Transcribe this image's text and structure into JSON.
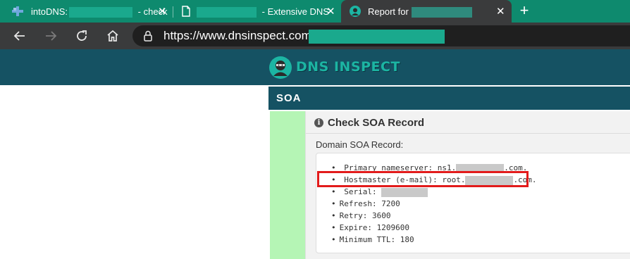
{
  "browser": {
    "tabs": [
      {
        "title": "intoDNS:",
        "suffix": "- check",
        "icon": "intodns-favicon-icon"
      },
      {
        "title": "",
        "suffix": "- Extensive DNS",
        "icon": "document-icon"
      },
      {
        "title": "Report for",
        "suffix": "",
        "icon": "dnsinspect-favicon-icon",
        "active": true
      }
    ],
    "close_glyph": "✕",
    "new_tab_glyph": "+",
    "url": "https://www.dnsinspect.com/",
    "accent": "#0e8a6e"
  },
  "site": {
    "logo_text": "DNS INSPECT",
    "header_color": "#155263"
  },
  "section": {
    "title": "SOA",
    "panel_title": "Check SOA Record",
    "domain_label": "Domain SOA Record:",
    "records": {
      "primary_ns_prefix": "Primary nameserver: ns1.",
      "primary_ns_suffix": ".com.",
      "hostmaster_prefix": "Hostmaster (e-mail): root.",
      "hostmaster_suffix": ".com.",
      "serial": "Serial:",
      "refresh": "Refresh: 7200",
      "retry": "Retry: 3600",
      "expire": "Expire: 1209600",
      "minimum_ttl": "Minimum TTL: 180"
    },
    "highlight_color": "#e21b1b"
  }
}
